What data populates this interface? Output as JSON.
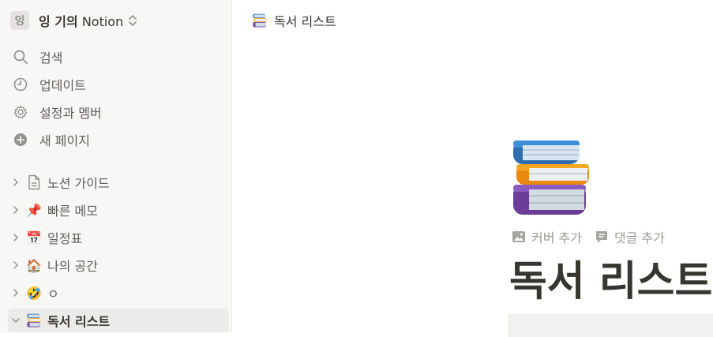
{
  "workspace": {
    "avatar_letter": "잉",
    "name_prefix": "잉 기의",
    "name_suffix": " Notion"
  },
  "nav": [
    {
      "label": "검색",
      "icon": "search-icon"
    },
    {
      "label": "업데이트",
      "icon": "clock-icon"
    },
    {
      "label": "설정과 멤버",
      "icon": "gear-icon"
    },
    {
      "label": "새 페이지",
      "icon": "plus-circle-icon"
    }
  ],
  "pages": [
    {
      "label": "노션 가이드",
      "icon": "document-icon"
    },
    {
      "label": "빠른 메모",
      "icon": "pushpin-icon",
      "emoji": "📌"
    },
    {
      "label": "일정표",
      "icon": "calendar-icon",
      "emoji": "📅"
    },
    {
      "label": "나의 공간",
      "icon": "house-icon",
      "emoji": "🏠"
    },
    {
      "label": "ㅇ",
      "icon": "laughing-face-icon",
      "emoji": "🤣"
    },
    {
      "label": "독서 리스트",
      "icon": "books-icon",
      "active": true
    }
  ],
  "topbar": {
    "breadcrumb": "독서 리스트"
  },
  "page": {
    "title": "독서 리스트",
    "add_cover": "커버 추가",
    "add_comment": "댓글 추가"
  },
  "colors": {
    "sidebar_bg": "#f7f7f5",
    "active_bg": "#ebebea",
    "text": "#37352f",
    "muted": "#9b9a97"
  }
}
